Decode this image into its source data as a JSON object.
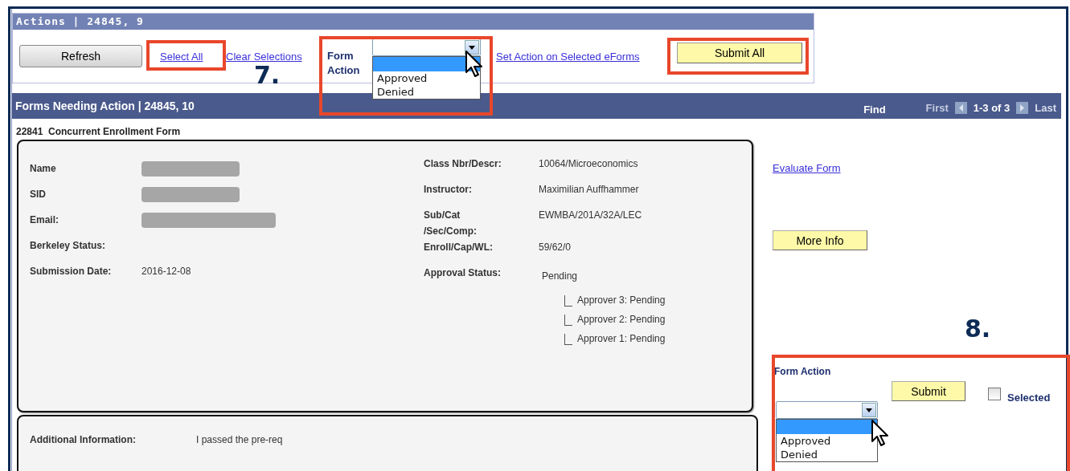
{
  "actions_panel": {
    "title": "Actions | 24845, 9",
    "refresh_button": "Refresh",
    "select_all_link": "Select All",
    "clear_selections_link": "Clear Selections",
    "form_action_label": "Form Action",
    "form_action_dropdown": {
      "expanded": true,
      "options": [
        {
          "label": "Approved",
          "selected": false
        },
        {
          "label": "Denied",
          "selected": false
        }
      ]
    },
    "set_action_link": "Set Action on Selected eForms",
    "submit_all_button": "Submit All"
  },
  "forms_panel": {
    "title": "Forms Needing Action | 24845, 10",
    "find_link": "Find",
    "pager": {
      "first": "First",
      "range": "1-3 of 3",
      "last": "Last"
    }
  },
  "form": {
    "number": "22841",
    "title": "Concurrent Enrollment Form",
    "left_fields": [
      {
        "label": "Name",
        "kind": "redacted"
      },
      {
        "label": "SID",
        "kind": "redacted"
      },
      {
        "label": "Email:",
        "kind": "redacted_wide"
      },
      {
        "label": "Berkeley Status:",
        "kind": "empty"
      },
      {
        "label": "Submission Date:",
        "kind": "text",
        "value": "2016-12-08"
      }
    ],
    "right_fields": [
      {
        "label": "Class Nbr/Descr:",
        "value": "10064/Microeconomics"
      },
      {
        "label": "Instructor:",
        "value": "Maximilian Auffhammer"
      },
      {
        "label": "Sub/Cat /Sec/Comp:",
        "value": "EWMBA/201A/32A/LEC"
      },
      {
        "label": "Enroll/Cap/WL:",
        "value": "59/62/0"
      },
      {
        "label": "Approval Status:",
        "value": "Pending",
        "children": [
          {
            "value": "Approver 3: Pending"
          },
          {
            "value": "Approver 2: Pending"
          },
          {
            "value": "Approver 1: Pending"
          }
        ]
      }
    ],
    "evaluate_link": "Evaluate Form",
    "more_info_button": "More Info",
    "row_action": {
      "label": "Form Action",
      "submit_button": "Submit",
      "selected_checkbox": {
        "label": "Selected",
        "checked": false
      },
      "dropdown": {
        "expanded": true,
        "options": [
          {
            "label": "Approved",
            "selected": false
          },
          {
            "label": "Denied",
            "selected": false
          }
        ]
      }
    },
    "additional_information": {
      "label": "Additional Information:",
      "value": "I passed the pre-req"
    }
  },
  "annotations": [
    {
      "label": "7."
    },
    {
      "label": "8."
    }
  ]
}
